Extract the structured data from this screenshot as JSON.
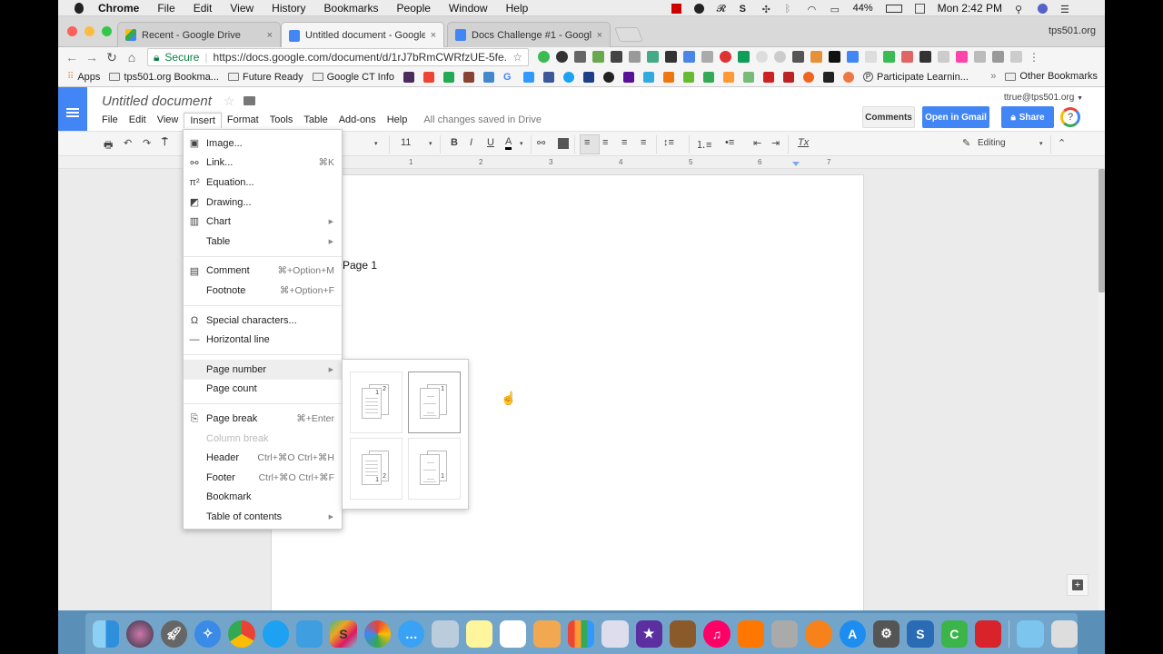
{
  "mac_menubar": {
    "app_name": "Chrome",
    "items": [
      "File",
      "Edit",
      "View",
      "History",
      "Bookmarks",
      "People",
      "Window",
      "Help"
    ],
    "battery": "44%",
    "clock": "Mon 2:42 PM"
  },
  "browser": {
    "tabs": [
      {
        "title": "Recent - Google Drive",
        "icon": "google-drive-icon",
        "active": false
      },
      {
        "title": "Untitled document - Google Dc",
        "icon": "google-docs-icon",
        "active": true
      },
      {
        "title": "Docs Challenge #1 - Google D",
        "icon": "google-docs-icon",
        "active": false
      }
    ],
    "profile_label": "tps501.org",
    "secure_label": "Secure",
    "url": "https://docs.google.com/document/d/1rJ7bRmCWRfzUE-5fe...",
    "bookmarks": [
      {
        "label": "Apps",
        "icon": "apps-grid-icon"
      },
      {
        "label": "tps501.org Bookma...",
        "icon": "folder-icon"
      },
      {
        "label": "Future Ready",
        "icon": "folder-icon"
      },
      {
        "label": "Google CT Info",
        "icon": "folder-icon"
      },
      {
        "label": "Participate Learnin...",
        "icon": "participate-icon"
      }
    ],
    "other_bookmarks": "Other Bookmarks"
  },
  "docs": {
    "title": "Untitled document",
    "menu": [
      "File",
      "Edit",
      "View",
      "Insert",
      "Format",
      "Tools",
      "Table",
      "Add-ons",
      "Help"
    ],
    "open_menu": "Insert",
    "save_status": "All changes saved in Drive",
    "account": "ttrue@tps501.org",
    "comments_label": "Comments",
    "open_gmail_label": "Open in Gmail",
    "share_label": "Share",
    "help_label": "?",
    "font_size": "11",
    "mode_label": "Editing",
    "ruler_numbers": [
      "1",
      "2",
      "3",
      "4",
      "5",
      "6",
      "7"
    ],
    "page_text": "Page 1"
  },
  "insert_menu": {
    "items": [
      {
        "label": "Image...",
        "icon": "image-icon",
        "shortcut": "",
        "submenu": false
      },
      {
        "label": "Link...",
        "icon": "link-icon",
        "shortcut": "⌘K",
        "submenu": false
      },
      {
        "label": "Equation...",
        "icon": "pi-icon",
        "shortcut": "",
        "submenu": false
      },
      {
        "label": "Drawing...",
        "icon": "drawing-icon",
        "shortcut": "",
        "submenu": false
      },
      {
        "label": "Chart",
        "icon": "chart-icon",
        "shortcut": "",
        "submenu": true
      },
      {
        "label": "Table",
        "icon": "",
        "shortcut": "",
        "submenu": true
      },
      {
        "label": "Comment",
        "icon": "comment-icon",
        "shortcut": "⌘+Option+M",
        "submenu": false
      },
      {
        "label": "Footnote",
        "icon": "",
        "shortcut": "⌘+Option+F",
        "submenu": false
      },
      {
        "label": "Special characters...",
        "icon": "omega-icon",
        "shortcut": "",
        "submenu": false
      },
      {
        "label": "Horizontal line",
        "icon": "horizontal-line-icon",
        "shortcut": "",
        "submenu": false
      },
      {
        "label": "Page number",
        "icon": "",
        "shortcut": "",
        "submenu": true,
        "highlighted": true
      },
      {
        "label": "Page count",
        "icon": "",
        "shortcut": "",
        "submenu": false
      },
      {
        "label": "Page break",
        "icon": "page-break-icon",
        "shortcut": "⌘+Enter",
        "submenu": false
      },
      {
        "label": "Column break",
        "icon": "",
        "shortcut": "",
        "submenu": false,
        "disabled": true
      },
      {
        "label": "Header",
        "icon": "",
        "shortcut": "Ctrl+⌘O Ctrl+⌘H",
        "submenu": false
      },
      {
        "label": "Footer",
        "icon": "",
        "shortcut": "Ctrl+⌘O Ctrl+⌘F",
        "submenu": false
      },
      {
        "label": "Bookmark",
        "icon": "",
        "shortcut": "",
        "submenu": false
      },
      {
        "label": "Table of contents",
        "icon": "",
        "shortcut": "",
        "submenu": true
      }
    ]
  },
  "page_number_submenu": {
    "options": [
      {
        "name": "header-all-pages",
        "numbers": [
          "1",
          "2"
        ]
      },
      {
        "name": "header-skip-first",
        "numbers": [
          "1"
        ],
        "hovered": true
      },
      {
        "name": "footer-all-pages",
        "numbers": [
          "1",
          "2"
        ]
      },
      {
        "name": "footer-skip-first",
        "numbers": [
          "1"
        ]
      }
    ]
  },
  "dock": {
    "apps": [
      "Finder",
      "Siri",
      "Launchpad",
      "Safari",
      "Chrome",
      "Twitterrific",
      "Twitter",
      "Slack",
      "Photos",
      "Messages",
      "Preview",
      "Notes",
      "Reminders",
      "Pages",
      "Numbers",
      "Keynote",
      "iMovie",
      "GarageBand",
      "iTunes",
      "Pages Doc",
      "Script Editor",
      "iBooks",
      "App Store",
      "System Preferences",
      "Snagit",
      "Camtasia",
      "Avira",
      "Downloads",
      "Trash"
    ]
  }
}
